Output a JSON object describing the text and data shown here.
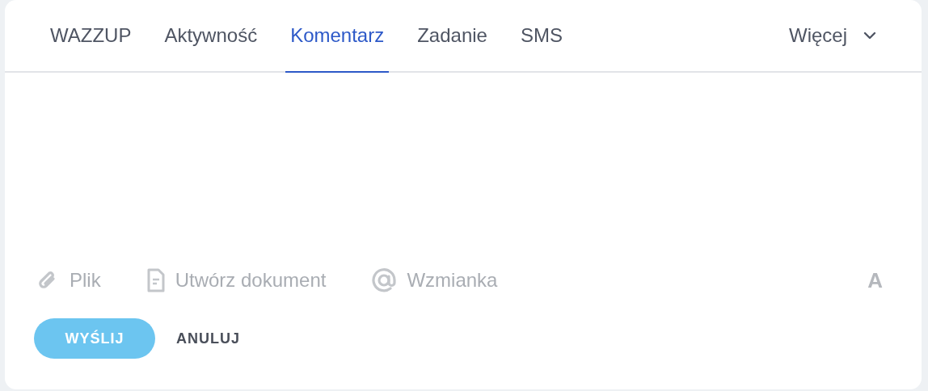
{
  "tabs": [
    {
      "label": "WAZZUP",
      "selected": false
    },
    {
      "label": "Aktywność",
      "selected": false
    },
    {
      "label": "Komentarz",
      "selected": true
    },
    {
      "label": "Zadanie",
      "selected": false
    },
    {
      "label": "SMS",
      "selected": false
    }
  ],
  "more": {
    "label": "Więcej",
    "expanded": false
  },
  "tools": [
    {
      "kind": "file",
      "label": "Plik"
    },
    {
      "kind": "document",
      "label": "Utwórz dokument"
    },
    {
      "kind": "mention",
      "label": "Wzmianka"
    }
  ],
  "format_button": "A",
  "buttons": [
    {
      "kind": "primary",
      "label": "WYŚLIJ"
    },
    {
      "kind": "plain",
      "label": "ANULUJ"
    }
  ]
}
